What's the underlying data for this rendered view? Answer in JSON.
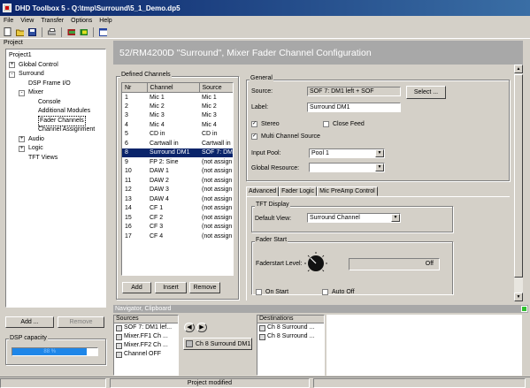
{
  "window": {
    "title": "DHD Toolbox 5 - Q:\\tmp\\Surround\\5_1_Demo.dp5"
  },
  "menu": [
    "File",
    "View",
    "Transfer",
    "Options",
    "Help"
  ],
  "toolbar_icons": [
    "new-file-icon",
    "open-folder-icon",
    "save-icon",
    "print-icon",
    "network-icon",
    "flag-icon",
    "window-icon"
  ],
  "project": {
    "label": "Project",
    "tree": [
      {
        "text": "Project1",
        "level": 0,
        "exp": ""
      },
      {
        "text": "Global Control",
        "level": 0,
        "exp": "+"
      },
      {
        "text": "Surround",
        "level": 0,
        "exp": "-"
      },
      {
        "text": "DSP Frame I/O",
        "level": 1,
        "exp": ""
      },
      {
        "text": "Mixer",
        "level": 1,
        "exp": "-"
      },
      {
        "text": "Console",
        "level": 2,
        "exp": ""
      },
      {
        "text": "Additional Modules",
        "level": 2,
        "exp": ""
      },
      {
        "text": "Fader Channels",
        "level": 2,
        "exp": "",
        "selected": true
      },
      {
        "text": "Channel Assignment",
        "level": 2,
        "exp": ""
      },
      {
        "text": "Audio",
        "level": 1,
        "exp": "+"
      },
      {
        "text": "Logic",
        "level": 1,
        "exp": "+"
      },
      {
        "text": "TFT Views",
        "level": 1,
        "exp": ""
      }
    ],
    "add_button": "Add ...",
    "remove_button": "Remove"
  },
  "dsp": {
    "label": "DSP capacity",
    "value_text": "88 %",
    "fraction": 0.88
  },
  "heading": "52/RM4200D \"Surround\", Mixer Fader Channel Configuration",
  "defined_channels": {
    "label": "Defined Channels",
    "columns": [
      "Nr",
      "Channel",
      "Source"
    ],
    "rows": [
      [
        "1",
        "Mic 1",
        "Mic 1"
      ],
      [
        "2",
        "Mic 2",
        "Mic 2"
      ],
      [
        "3",
        "Mic 3",
        "Mic 3"
      ],
      [
        "4",
        "Mic 4",
        "Mic 4"
      ],
      [
        "5",
        "CD in",
        "CD in"
      ],
      [
        "6",
        "Cartwall in",
        "Cartwall in"
      ],
      [
        "8",
        "Surround DM1",
        "SOF 7: DM"
      ],
      [
        "9",
        "FP 2: Sine",
        "(not assign"
      ],
      [
        "10",
        "DAW 1",
        "(not assign"
      ],
      [
        "11",
        "DAW 2",
        "(not assign"
      ],
      [
        "12",
        "DAW 3",
        "(not assign"
      ],
      [
        "13",
        "DAW 4",
        "(not assign"
      ],
      [
        "14",
        "CF 1",
        "(not assign"
      ],
      [
        "15",
        "CF 2",
        "(not assign"
      ],
      [
        "16",
        "CF 3",
        "(not assign"
      ],
      [
        "17",
        "CF 4",
        "(not assign"
      ]
    ],
    "selected_row": 6,
    "add": "Add",
    "insert": "Insert",
    "remove": "Remove"
  },
  "general": {
    "label": "General",
    "source_label": "Source:",
    "source_value": "SOF 7: DM1 left + SOF",
    "select_button": "Select ...",
    "label_label": "Label:",
    "label_value": "Surround DM1",
    "stereo": "Stereo",
    "close_feed": "Close Feed",
    "multi": "Multi Channel Source",
    "input_pool_label": "Input Pool:",
    "input_pool_value": "Pool 1",
    "global_resource_label": "Global Resource:",
    "global_resource_value": ""
  },
  "tabs": [
    "Advanced",
    "Fader Logic",
    "Mic PreAmp Control"
  ],
  "tft": {
    "label": "TFT Display",
    "default_view_label": "Default View:",
    "default_view_value": "Surround Channel"
  },
  "fader_start": {
    "label": "Fader Start",
    "level_label": "Faderstart Level:",
    "level_value": "Off",
    "on_start": "On Start",
    "auto_off": "Auto Off"
  },
  "navigator": {
    "title": "Navigator, Clipboard",
    "sources_label": "Sources",
    "sources": [
      "SOF 7: DM1 lef...",
      "Mixer.FF1 Ch ...",
      "Mixer.FF2 Ch ...",
      "Channel OFF"
    ],
    "middle_button": "Ch 8 Surround DM1",
    "destinations_label": "Destinations",
    "destinations": [
      "Ch 8 Surround ...",
      "Ch 8 Surround ..."
    ]
  },
  "status": {
    "text": "Project modified"
  }
}
